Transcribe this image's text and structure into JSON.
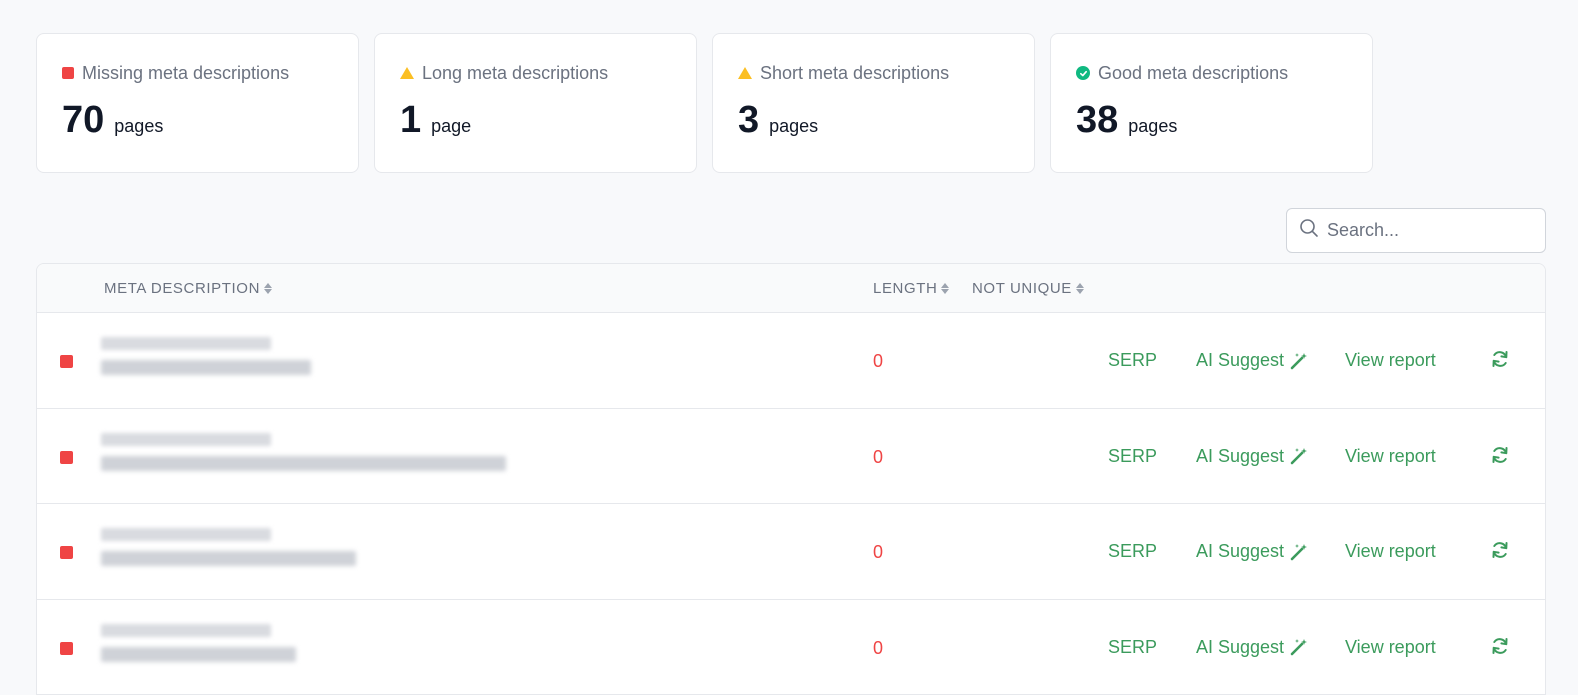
{
  "summary_cards": [
    {
      "label": "Missing meta descriptions",
      "value": "70",
      "unit": "pages",
      "status": "missing"
    },
    {
      "label": "Long meta descriptions",
      "value": "1",
      "unit": "page",
      "status": "warning"
    },
    {
      "label": "Short meta descriptions",
      "value": "3",
      "unit": "pages",
      "status": "warning"
    },
    {
      "label": "Good meta descriptions",
      "value": "38",
      "unit": "pages",
      "status": "good"
    }
  ],
  "search": {
    "placeholder": "Search..."
  },
  "table": {
    "columns": {
      "meta_description": "META DESCRIPTION",
      "length": "LENGTH",
      "not_unique": "NOT UNIQUE"
    },
    "rows": [
      {
        "status": "missing",
        "length": "0",
        "serp": "SERP",
        "ai_suggest": "AI Suggest",
        "view_report": "View report"
      },
      {
        "status": "missing",
        "length": "0",
        "serp": "SERP",
        "ai_suggest": "AI Suggest",
        "view_report": "View report"
      },
      {
        "status": "missing",
        "length": "0",
        "serp": "SERP",
        "ai_suggest": "AI Suggest",
        "view_report": "View report"
      },
      {
        "status": "missing",
        "length": "0",
        "serp": "SERP",
        "ai_suggest": "AI Suggest",
        "view_report": "View report"
      }
    ]
  },
  "colors": {
    "missing": "#ef4444",
    "warning": "#fbbf24",
    "good": "#10b981",
    "action": "#3b9b5c"
  }
}
